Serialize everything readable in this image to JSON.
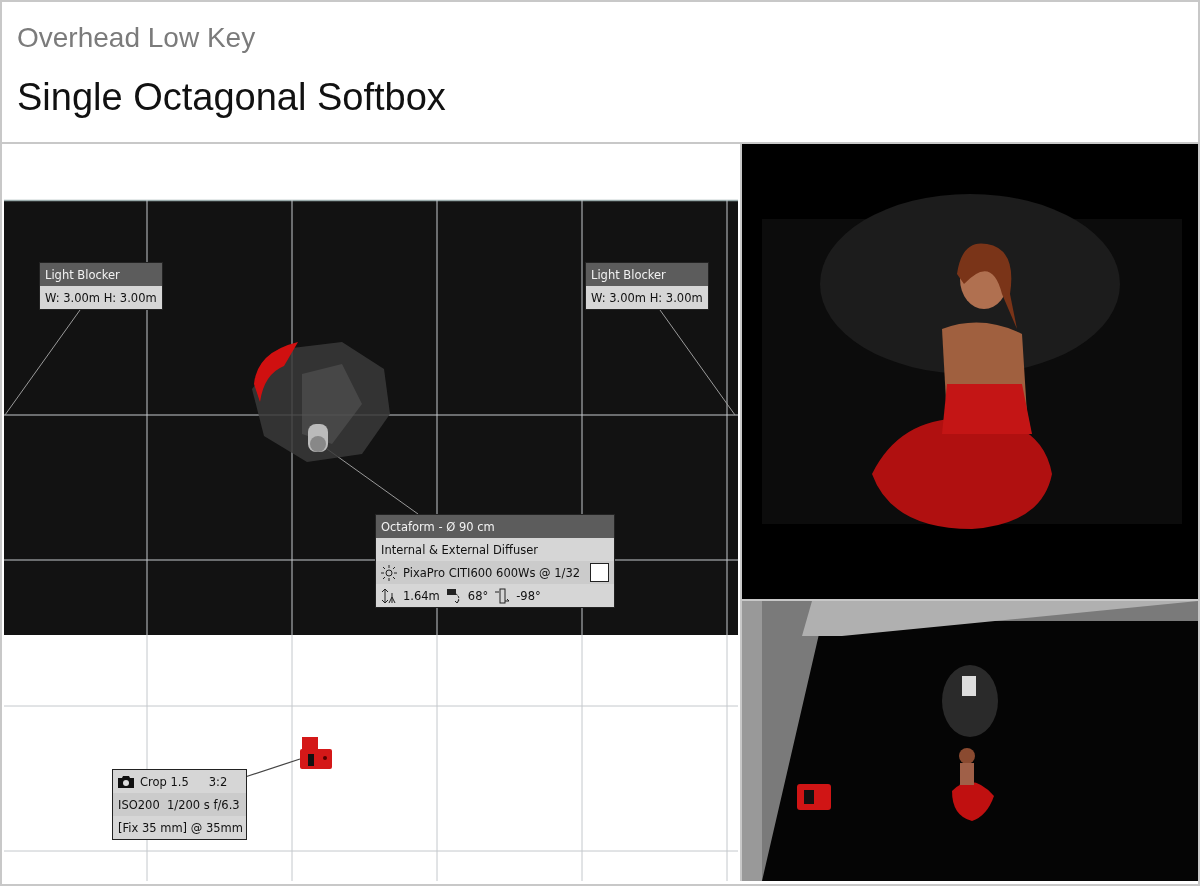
{
  "header": {
    "subtitle": "Overhead Low Key",
    "title": "Single Octagonal Softbox"
  },
  "light_blockers": [
    {
      "title": "Light Blocker",
      "size": "W: 3.00m H: 3.00m"
    },
    {
      "title": "Light Blocker",
      "size": "W: 3.00m H: 3.00m"
    }
  ],
  "softbox": {
    "title": "Octaform - Ø 90 cm",
    "diffuser": "Internal & External Diffuser",
    "flash": "PixaPro CITI600 600Ws @ 1/32",
    "height": "1.64m",
    "tilt": "68°",
    "rotation": "-98°"
  },
  "camera": {
    "crop": "Crop 1.5",
    "ratio": "3:2",
    "exposure": "ISO200  1/200 s f/6.3",
    "lens": "[Fix 35 mm] @ 35mm"
  }
}
